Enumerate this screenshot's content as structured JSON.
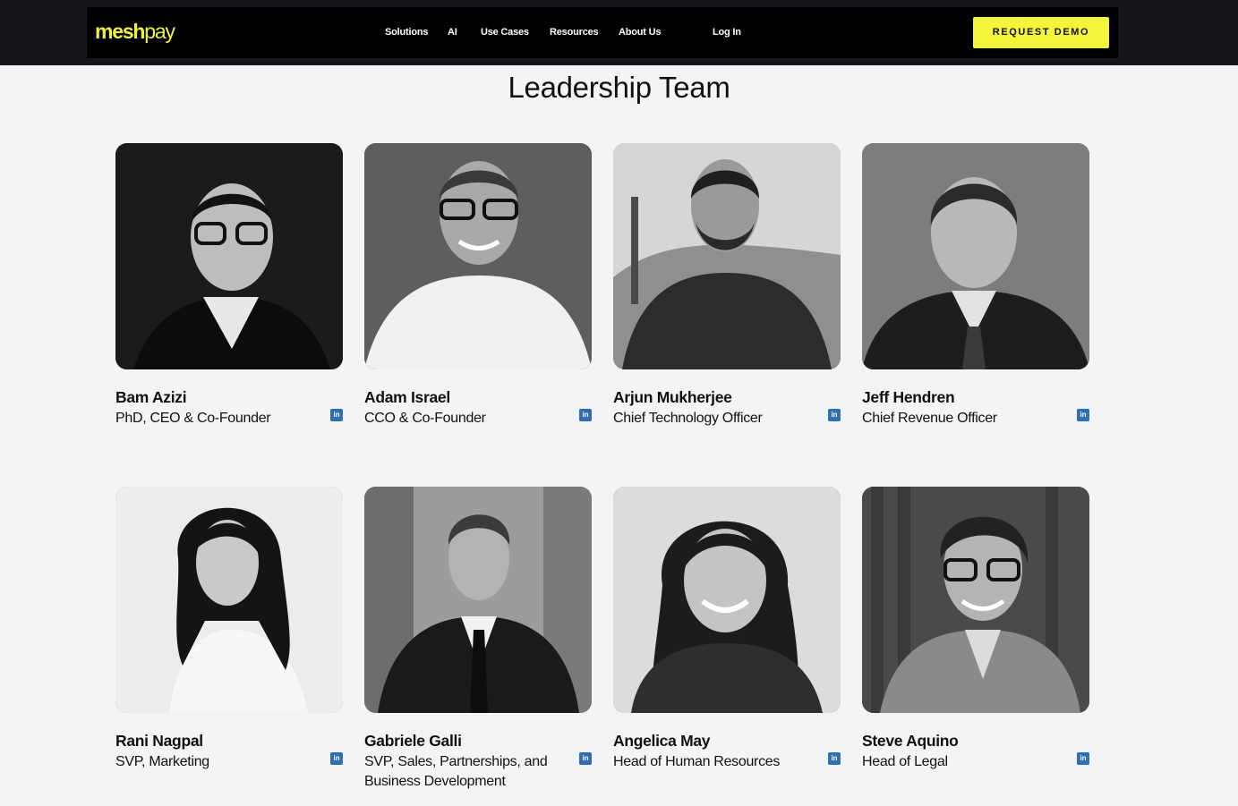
{
  "brand": {
    "logo_part1": "mesh",
    "logo_part2": "pay",
    "accent": "#f3f53c"
  },
  "nav": {
    "items": [
      "Solutions",
      "AI",
      "Use Cases",
      "Resources",
      "About Us"
    ],
    "login": "Log In",
    "cta": "REQUEST DEMO"
  },
  "section": {
    "title": "Leadership Team"
  },
  "team": [
    {
      "name": "Bam Azizi",
      "role": "PhD, CEO & Co-Founder",
      "icon": "linkedin-icon"
    },
    {
      "name": "Adam Israel",
      "role": "CCO & Co-Founder",
      "icon": "linkedin-icon"
    },
    {
      "name": "Arjun Mukherjee",
      "role": "Chief Technology Officer",
      "icon": "linkedin-icon"
    },
    {
      "name": "Jeff Hendren",
      "role": "Chief Revenue Officer",
      "icon": "linkedin-icon"
    },
    {
      "name": "Rani Nagpal",
      "role": "SVP, Marketing",
      "icon": "linkedin-icon"
    },
    {
      "name": "Gabriele Galli",
      "role": "SVP, Sales, Partnerships, and Business Development",
      "icon": "linkedin-icon"
    },
    {
      "name": "Angelica May",
      "role": "Head of Human Resources",
      "icon": "linkedin-icon"
    },
    {
      "name": "Steve Aquino",
      "role": "Head of Legal",
      "icon": "linkedin-icon"
    }
  ]
}
